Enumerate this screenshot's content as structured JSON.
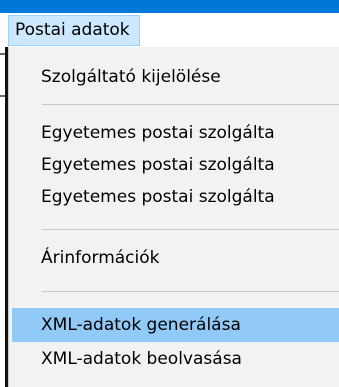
{
  "menubar": {
    "items": [
      {
        "label": "Postai adatok"
      }
    ]
  },
  "dropdown": {
    "items": [
      {
        "label": "Szolgáltató kijelölése"
      },
      {
        "label": "Egyetemes postai szolgálta"
      },
      {
        "label": "Egyetemes postai szolgálta"
      },
      {
        "label": "Egyetemes postai szolgálta"
      },
      {
        "label": "Árinformációk"
      },
      {
        "label": "XML-adatok generálása",
        "highlighted": true
      },
      {
        "label": "XML-adatok beolvasása"
      }
    ]
  },
  "colors": {
    "titlebar": "#0078d7",
    "menubar_selected_bg": "#cce8ff",
    "menubar_selected_border": "#99d1ff",
    "dropdown_bg": "#f2f2f2",
    "highlight_bg": "#91c9f7",
    "separator": "#cacaca"
  }
}
